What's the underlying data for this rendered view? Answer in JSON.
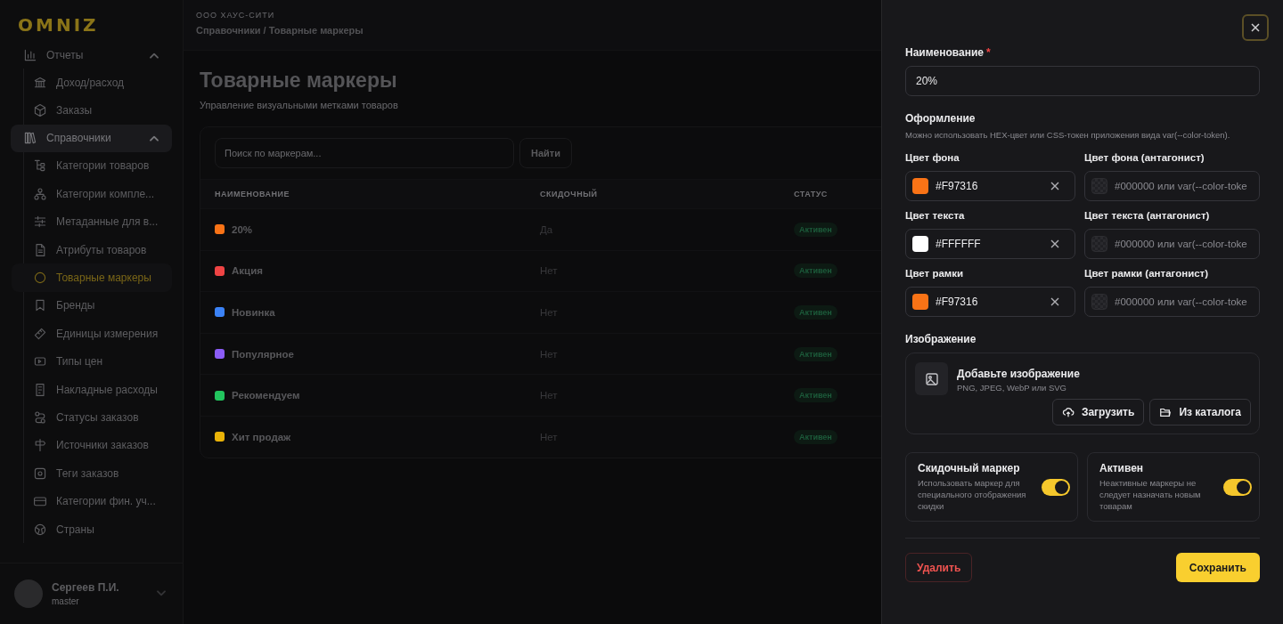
{
  "sidebar": {
    "logo": "OMNIZ",
    "groups": [
      {
        "label": "Отчеты",
        "expanded": true,
        "selected": false,
        "children": [
          {
            "label": "Доход/расход",
            "selected": false
          },
          {
            "label": "Заказы",
            "selected": false
          }
        ]
      },
      {
        "label": "Справочники",
        "expanded": true,
        "selected": true,
        "children": [
          {
            "label": "Категории товаров",
            "selected": false
          },
          {
            "label": "Категории компле...",
            "selected": false
          },
          {
            "label": "Метаданные для в...",
            "selected": false
          },
          {
            "label": "Атрибуты товаров",
            "selected": false
          },
          {
            "label": "Товарные маркеры",
            "selected": true
          },
          {
            "label": "Бренды",
            "selected": false
          },
          {
            "label": "Единицы измерения",
            "selected": false
          },
          {
            "label": "Типы цен",
            "selected": false
          },
          {
            "label": "Накладные расходы",
            "selected": false
          },
          {
            "label": "Статусы заказов",
            "selected": false
          },
          {
            "label": "Источники заказов",
            "selected": false
          },
          {
            "label": "Теги заказов",
            "selected": false
          },
          {
            "label": "Категории фин. уч...",
            "selected": false
          },
          {
            "label": "Страны",
            "selected": false
          }
        ]
      }
    ],
    "user": {
      "name": "Сергеев П.И.",
      "role": "master"
    }
  },
  "main": {
    "company": "ООО ХАУС-СИТИ",
    "breadcrumb": "Справочники / Товарные маркеры",
    "title": "Товарные маркеры",
    "subtitle": "Управление визуальными метками товаров",
    "search": {
      "placeholder": "Поиск по маркерам..."
    },
    "search_button": "Найти",
    "table": {
      "columns": [
        "НАИМЕНОВАНИЕ",
        "СКИДОЧНЫЙ",
        "СТАТУС"
      ],
      "rows": [
        {
          "color": "#f97316",
          "name": "20%",
          "discount": "Да",
          "status": "Активен"
        },
        {
          "color": "#ef4444",
          "name": "Акция",
          "discount": "Нет",
          "status": "Активен"
        },
        {
          "color": "#3b82f6",
          "name": "Новинка",
          "discount": "Нет",
          "status": "Активен"
        },
        {
          "color": "#8b5cf6",
          "name": "Популярное",
          "discount": "Нет",
          "status": "Активен"
        },
        {
          "color": "#22c55e",
          "name": "Рекомендуем",
          "discount": "Нет",
          "status": "Активен"
        },
        {
          "color": "#eab308",
          "name": "Хит продаж",
          "discount": "Нет",
          "status": "Активен"
        }
      ]
    }
  },
  "drawer": {
    "name_field": {
      "label": "Наименование",
      "required_mark": "*",
      "value": "20%"
    },
    "design": {
      "title": "Оформление",
      "hint": "Можно использовать HEX-цвет или CSS-токен приложения вида var(--color-token).",
      "color_rows": [
        {
          "main": {
            "label": "Цвет фона",
            "color": "#f97316",
            "value": "#F97316"
          },
          "antagonist": {
            "label": "Цвет фона (антагонист)",
            "placeholder": "#000000 или var(--color-toke"
          }
        },
        {
          "main": {
            "label": "Цвет текста",
            "color": "#ffffff",
            "value": "#FFFFFF"
          },
          "antagonist": {
            "label": "Цвет текста (антагонист)",
            "placeholder": "#000000 или var(--color-toke"
          }
        },
        {
          "main": {
            "label": "Цвет рамки",
            "color": "#f97316",
            "value": "#F97316"
          },
          "antagonist": {
            "label": "Цвет рамки (антагонист)",
            "placeholder": "#000000 или var(--color-toke"
          }
        }
      ]
    },
    "image": {
      "label": "Изображение",
      "title": "Добавьте изображение",
      "formats": "PNG, JPEG, WebP или SVG",
      "upload_button": "Загрузить",
      "catalog_button": "Из каталога"
    },
    "toggles": [
      {
        "title": "Скидочный маркер",
        "description": "Использовать маркер для специального отображения скидки",
        "on": true
      },
      {
        "title": "Активен",
        "description": "Неактивные маркеры не следует назначать новым товарам",
        "on": true
      }
    ],
    "delete_button": "Удалить",
    "save_button": "Сохранить"
  }
}
